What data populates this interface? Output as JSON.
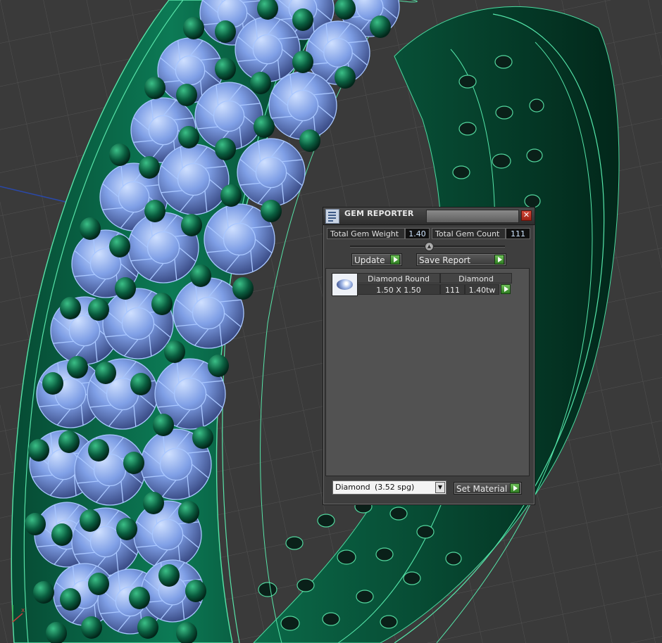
{
  "panel": {
    "title": "GEM REPORTER",
    "close_glyph": "✕",
    "total_weight_label": "Total Gem Weight",
    "total_weight_value": "1.40",
    "total_count_label": "Total Gem Count",
    "total_count_value": "111",
    "update_label": "Update",
    "save_report_label": "Save Report",
    "table": {
      "headers": [
        "Diamond Round",
        "Diamond"
      ],
      "rows": [
        {
          "icon": "diamond-thumbnail-icon",
          "size": "1.50 X 1.50",
          "count": "111",
          "weight": "1.40tw"
        }
      ]
    },
    "material_select": {
      "name": "Diamond",
      "spg": "(3.52 spg)"
    },
    "set_material_label": "Set Material"
  },
  "colors": {
    "ring_green": "#0e7a55",
    "gem_blue": "#8fb4ff",
    "viewport_bg": "#3b3b3b",
    "accent_green": "#3fa52c"
  },
  "icons": {
    "app": "gem-reporter-app-icon",
    "close": "close-icon",
    "play": "play-arrow-icon",
    "dropdown": "chevron-down-icon",
    "axis": "axis-gizmo-icon"
  }
}
